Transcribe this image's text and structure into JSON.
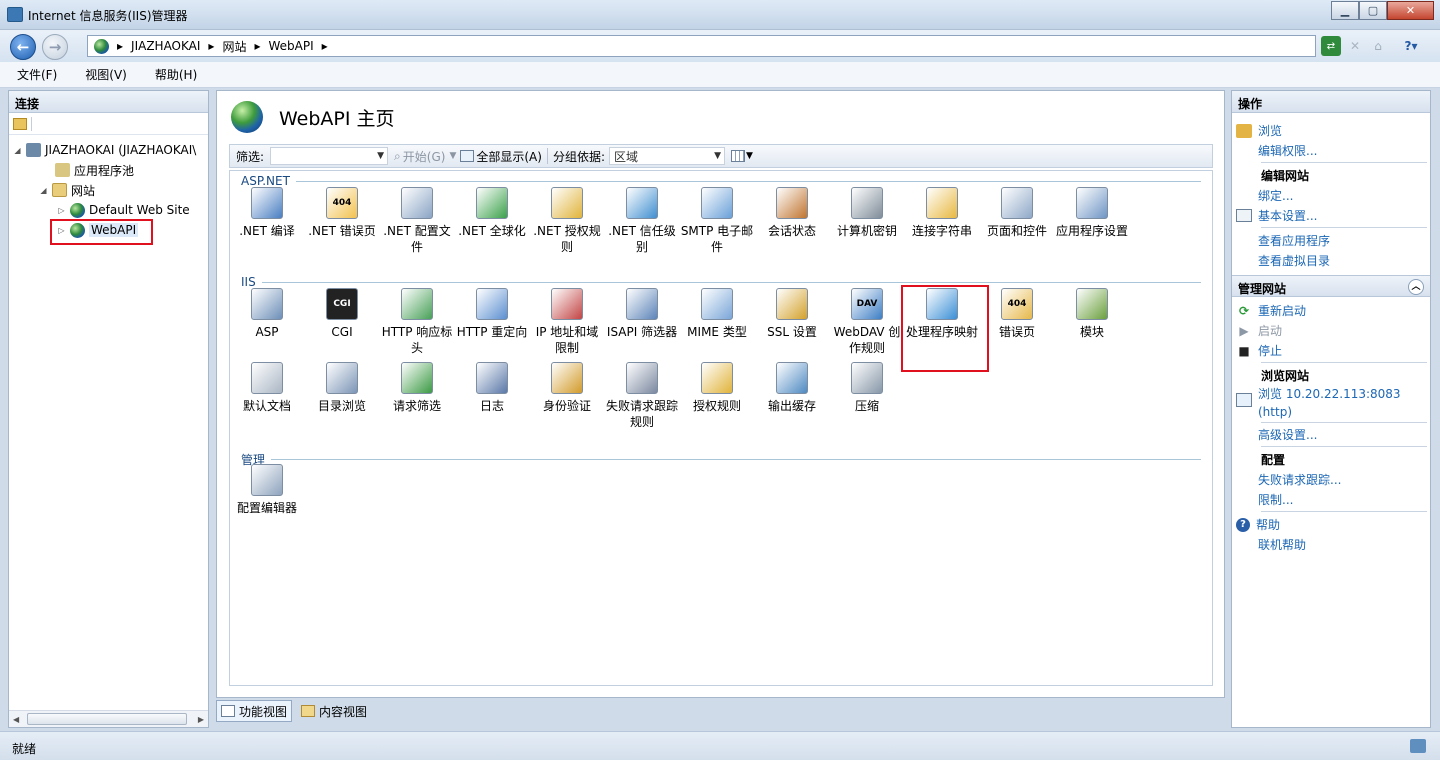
{
  "window": {
    "title": "Internet 信息服务(IIS)管理器"
  },
  "nav": {
    "breadcrumb": [
      "JIAZHAOKAI",
      "网站",
      "WebAPI"
    ]
  },
  "menu": [
    "文件(F)",
    "视图(V)",
    "帮助(H)"
  ],
  "connections": {
    "header": "连接",
    "tree": [
      {
        "label": "JIAZHAOKAI (JIAZHAOKAI\\",
        "level": 0
      },
      {
        "label": "应用程序池",
        "level": 1
      },
      {
        "label": "网站",
        "level": 1
      },
      {
        "label": "Default Web Site",
        "level": 2
      },
      {
        "label": "WebAPI",
        "level": 2
      }
    ]
  },
  "center": {
    "title": "WebAPI 主页",
    "filter": {
      "label": "筛选:",
      "start": "开始(G)",
      "show_all": "全部显示(A)",
      "group_by": "分组依据:",
      "group_value": "区域"
    },
    "groups": [
      {
        "name": "ASP.NET",
        "items": [
          ".NET 编译",
          ".NET 错误页",
          ".NET 配置文件",
          ".NET 全球化",
          ".NET 授权规则",
          ".NET 信任级别",
          "SMTP 电子邮件",
          "会话状态",
          "计算机密钥",
          "连接字符串",
          "页面和控件",
          "应用程序设置"
        ]
      },
      {
        "name": "IIS",
        "items": [
          "ASP",
          "CGI",
          "HTTP 响应标头",
          "HTTP 重定向",
          "IP 地址和域限制",
          "ISAPI 筛选器",
          "MIME 类型",
          "SSL 设置",
          "WebDAV 创作规则",
          "处理程序映射",
          "错误页",
          "模块",
          "默认文档",
          "目录浏览",
          "请求筛选",
          "日志",
          "身份验证",
          "失败请求跟踪规则",
          "授权规则",
          "输出缓存",
          "压缩"
        ]
      },
      {
        "name": "管理",
        "items": [
          "配置编辑器"
        ]
      }
    ],
    "icon_glyphs": {
      "cgi": "CGI",
      "dav": "DAV",
      "err": "404"
    },
    "view_tabs": [
      "功能视图",
      "内容视图"
    ]
  },
  "actions": {
    "header": "操作",
    "items": {
      "browse": "浏览",
      "edit_perm": "编辑权限...",
      "edit_site": "编辑网站",
      "bind": "绑定...",
      "basic": "基本设置...",
      "view_app": "查看应用程序",
      "view_vdir": "查看虚拟目录",
      "manage": "管理网站",
      "restart": "重新启动",
      "start": "启动",
      "stop": "停止",
      "browse_site": "浏览网站",
      "browse_url": "浏览 10.20.22.113:8083",
      "browse_proto": "(http)",
      "advanced": "高级设置...",
      "config": "配置",
      "failed_trace": "失败请求跟踪...",
      "limits": "限制...",
      "help": "帮助",
      "online_help": "联机帮助"
    }
  },
  "status": "就绪"
}
